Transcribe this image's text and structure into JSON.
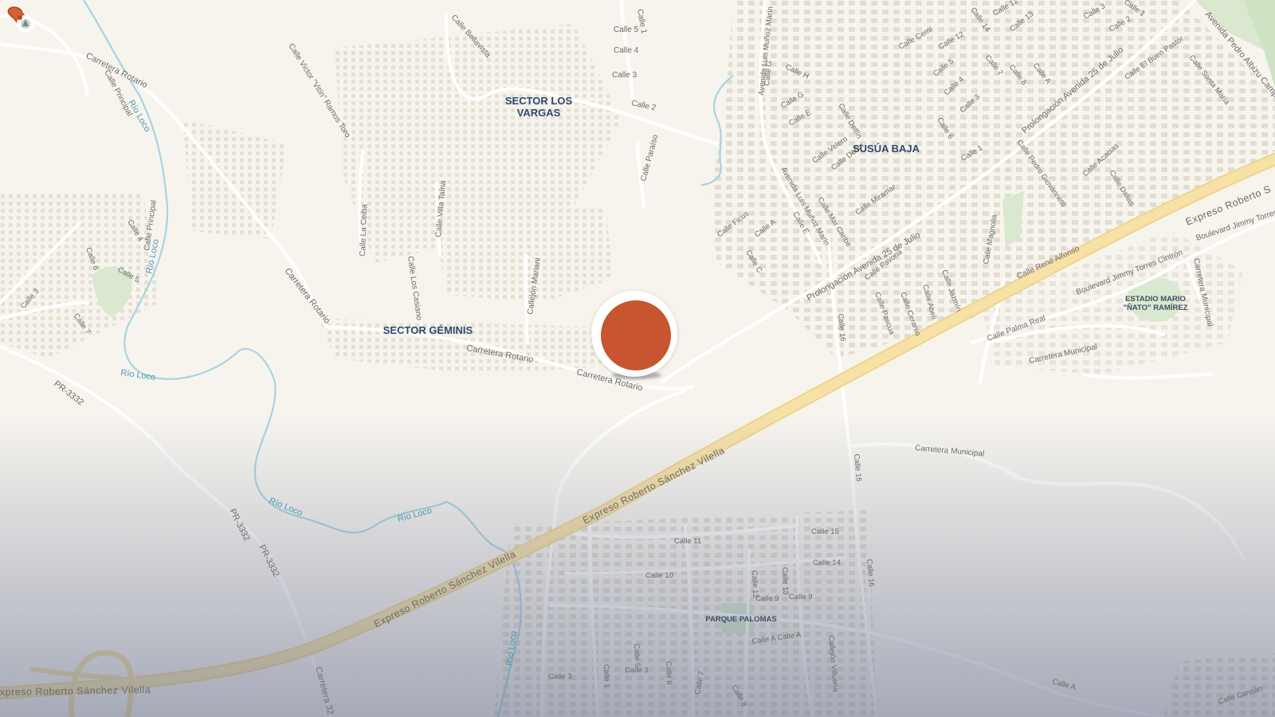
{
  "map": {
    "areas": {
      "sector_los_vargas": "SECTOR LOS\nVARGAS",
      "susua_baja": "SUSÚA BAJA",
      "sector_geminis": "SECTOR GÉMINIS",
      "estadio": "ESTADIO MARIO\n\"ÑATO\" RAMÍREZ",
      "parque_palomas": "PARQUE PALOMAS"
    },
    "highway": {
      "label_a": "Expreso Roberto Sánchez Vilella",
      "label_b": "Expreso Roberto Sánchez Vilella",
      "label_c": "xpreso Roberto Sánchez Vilella",
      "label_d": "Expreso Roberto S"
    },
    "roads": [
      {
        "id": "carretera-rotario-1",
        "text": "Carretera Rotario"
      },
      {
        "id": "carretera-rotario-2",
        "text": "Carretera Rotario"
      },
      {
        "id": "carretera-rotario-3",
        "text": "Carretera Rotario"
      },
      {
        "id": "carretera-rotario-4",
        "text": "Carretera Rotario"
      },
      {
        "id": "pr-3332-1",
        "text": "PR-3332"
      },
      {
        "id": "pr-3332-2",
        "text": "PR-3332"
      },
      {
        "id": "pr-3332-3",
        "text": "PR-3332"
      },
      {
        "id": "carretera-32",
        "text": "Carretera 32"
      },
      {
        "id": "prolongacion-1",
        "text": "Prolongación Avenida 25 de Julio"
      },
      {
        "id": "prolongacion-2",
        "text": "Prolongación Avenida 25 de Julio"
      },
      {
        "id": "avenida-pedro-albizu",
        "text": "Avenida Pedro Albizu Camp"
      },
      {
        "id": "boulevard-jimmy-1",
        "text": "Boulevard Jimmy Torres"
      },
      {
        "id": "boulevard-jimmy-2",
        "text": "Boulevard Jimmy Torres Cintrón"
      },
      {
        "id": "carretera-municipal-1",
        "text": "Carretera Municipal"
      },
      {
        "id": "carretera-municipal-2",
        "text": "Carretera Municipal"
      },
      {
        "id": "carretera-municipal-3",
        "text": "Carretera Municipal"
      },
      {
        "id": "calle-palma-real",
        "text": "Calle Palma Real"
      },
      {
        "id": "calle-rene-alfonso",
        "text": "Calle René Alfonso"
      },
      {
        "id": "calle-principal-1",
        "text": "Calle Principal"
      },
      {
        "id": "calle-principal-2",
        "text": "Calle Principal"
      },
      {
        "id": "calle-victor",
        "text": "Calle Victor \"Vitín\" Ramos Toro"
      },
      {
        "id": "calle-bellavista",
        "text": "Calle Bellavista"
      },
      {
        "id": "calle-la-ceiba",
        "text": "Calle La Ceiba"
      },
      {
        "id": "calle-villa-taina",
        "text": "Calle Villa Taína"
      },
      {
        "id": "calle-los-casiano",
        "text": "Calle Los Casiano"
      },
      {
        "id": "callejon-mariani",
        "text": "Callejón Mariani"
      },
      {
        "id": "calle-paraiso",
        "text": "Calle Paraíso"
      },
      {
        "id": "calle-5-a",
        "text": "Calle 5"
      },
      {
        "id": "calle-4-a",
        "text": "Calle 4"
      },
      {
        "id": "calle-3-a",
        "text": "Calle 3"
      },
      {
        "id": "calle-2-a",
        "text": "Calle 2"
      },
      {
        "id": "calle-1-a",
        "text": "Calle 1"
      },
      {
        "id": "av-luis-munoz-1",
        "text": "Avenida Luis Muñoz Marín"
      },
      {
        "id": "av-luis-munoz-2",
        "text": "Avenida Luis Muñoz Marín"
      },
      {
        "id": "calle-g",
        "text": "Calle G"
      },
      {
        "id": "calle-h",
        "text": "Calle H"
      },
      {
        "id": "calle-g2",
        "text": "Calle G"
      },
      {
        "id": "calle-e",
        "text": "Calle E"
      },
      {
        "id": "calle-delfin-1",
        "text": "Calle Delfín"
      },
      {
        "id": "calle-delfin-2",
        "text": "Calle Delfín"
      },
      {
        "id": "calle-velero",
        "text": "Calle Velero"
      },
      {
        "id": "calle-miramar",
        "text": "Calle Miramar"
      },
      {
        "id": "calle-mar-caribe",
        "text": "Calle Mar Caribe"
      },
      {
        "id": "calle-ficus",
        "text": "Calle Ficus"
      },
      {
        "id": "calle-a-1",
        "text": "Calle A"
      },
      {
        "id": "calle-e2",
        "text": "Calle E"
      },
      {
        "id": "calle-c",
        "text": "Calle C"
      },
      {
        "id": "calle-pavona",
        "text": "Calle Pavona"
      },
      {
        "id": "calle-pascua",
        "text": "Calle Pascua"
      },
      {
        "id": "calle-ceranio",
        "text": "Calle Ceranio"
      },
      {
        "id": "calle-abeli",
        "text": "Calle Abeli"
      },
      {
        "id": "calle-jazmin",
        "text": "Calle Jazmín"
      },
      {
        "id": "calle-magnolia",
        "text": "Calle Magnolia"
      },
      {
        "id": "calle-pedro-giovannetti",
        "text": "Calle Pedro Giovannetti"
      },
      {
        "id": "calle-acacias",
        "text": "Calle Acacias"
      },
      {
        "id": "calle-dalias",
        "text": "Calle Dalias"
      },
      {
        "id": "calle-cemi",
        "text": "Calle Cemí"
      },
      {
        "id": "calle-12",
        "text": "Calle 12"
      },
      {
        "id": "calle-12b",
        "text": "Calle 12"
      },
      {
        "id": "calle-13",
        "text": "Calle 13"
      },
      {
        "id": "calle-14",
        "text": "Calle 14"
      },
      {
        "id": "calle-5-b",
        "text": "Calle 5"
      },
      {
        "id": "calle-4-b",
        "text": "Calle 4"
      },
      {
        "id": "calle-3-b",
        "text": "Calle 3"
      },
      {
        "id": "calle-6-b",
        "text": "Calle 6"
      },
      {
        "id": "calle-1-b",
        "text": "Calle 1"
      },
      {
        "id": "calle-7-b",
        "text": "Calle 7"
      },
      {
        "id": "calle-8-b",
        "text": "Calle 8"
      },
      {
        "id": "calle-a-b",
        "text": "Calle A"
      },
      {
        "id": "calle-el-buen-pastor",
        "text": "Calle El Buen Pastor"
      },
      {
        "id": "calle-santa-maria",
        "text": "Calle Santa María"
      },
      {
        "id": "calle-1-c",
        "text": "Calle 1"
      },
      {
        "id": "calle-2-c",
        "text": "Calle 2"
      },
      {
        "id": "calle-3-c",
        "text": "Calle 3"
      },
      {
        "id": "calle-16-a",
        "text": "Calle 16"
      },
      {
        "id": "calle-16-b",
        "text": "Calle 16"
      },
      {
        "id": "calle-16-c",
        "text": "Calle 16"
      },
      {
        "id": "calle-11",
        "text": "Calle 11"
      },
      {
        "id": "calle-10",
        "text": "Calle 10"
      },
      {
        "id": "calle-15",
        "text": "Calle 15"
      },
      {
        "id": "calle-14-b",
        "text": "Calle 14"
      },
      {
        "id": "calle-9-a",
        "text": "Calle 9"
      },
      {
        "id": "calle-9-b",
        "text": "Calle 9"
      },
      {
        "id": "calle-12-c",
        "text": "Calle 12"
      },
      {
        "id": "calle-13-c",
        "text": "Calle 13"
      },
      {
        "id": "calle-a-calle-a",
        "text": "Calle A Calle A"
      },
      {
        "id": "calle-3-d",
        "text": "Calle 3"
      },
      {
        "id": "calle-1-d",
        "text": "Calle 1"
      },
      {
        "id": "calle-5-d",
        "text": "Calle 5"
      },
      {
        "id": "calle-3-e",
        "text": "Calle 3"
      },
      {
        "id": "calle-6-d",
        "text": "Calle 6"
      },
      {
        "id": "calle-7-d",
        "text": "Calle 7"
      },
      {
        "id": "calle-8-d",
        "text": "Calle 8"
      },
      {
        "id": "callejon-villuena",
        "text": "Callejón Villuena"
      },
      {
        "id": "calle-a-e",
        "text": "Calle A"
      },
      {
        "id": "calle-canaan",
        "text": "Calle Canaán"
      },
      {
        "id": "calle-3-w",
        "text": "Calle 3"
      },
      {
        "id": "calle-4-w",
        "text": "Calle 4"
      },
      {
        "id": "calle-5-w",
        "text": "Calle 5"
      },
      {
        "id": "calle-6-w",
        "text": "Calle 6"
      },
      {
        "id": "calle-7-w",
        "text": "Calle 7"
      }
    ],
    "rivers": [
      {
        "id": "rio-loco-1",
        "text": "Río Loco"
      },
      {
        "id": "rio-loco-2",
        "text": "Río Loco"
      },
      {
        "id": "rio-loco-3",
        "text": "Río Loco"
      },
      {
        "id": "rio-loco-4",
        "text": "Río Loco"
      },
      {
        "id": "rio-loco-5",
        "text": "Río Loco"
      },
      {
        "id": "rio-loco-6",
        "text": "Río Loco"
      }
    ],
    "colors": {
      "background": "#f7f4ee",
      "road": "#ffffff",
      "highway": "#f3dc9e",
      "water": "#9fd3e2",
      "park": "#dcead3",
      "building": "#e4ded2",
      "area_label": "#2c4a6e",
      "road_label": "#6d6a66",
      "water_label": "#4b97b3",
      "pin": "#c7552f"
    },
    "pin_icon": "megaphone-pin-icon"
  }
}
